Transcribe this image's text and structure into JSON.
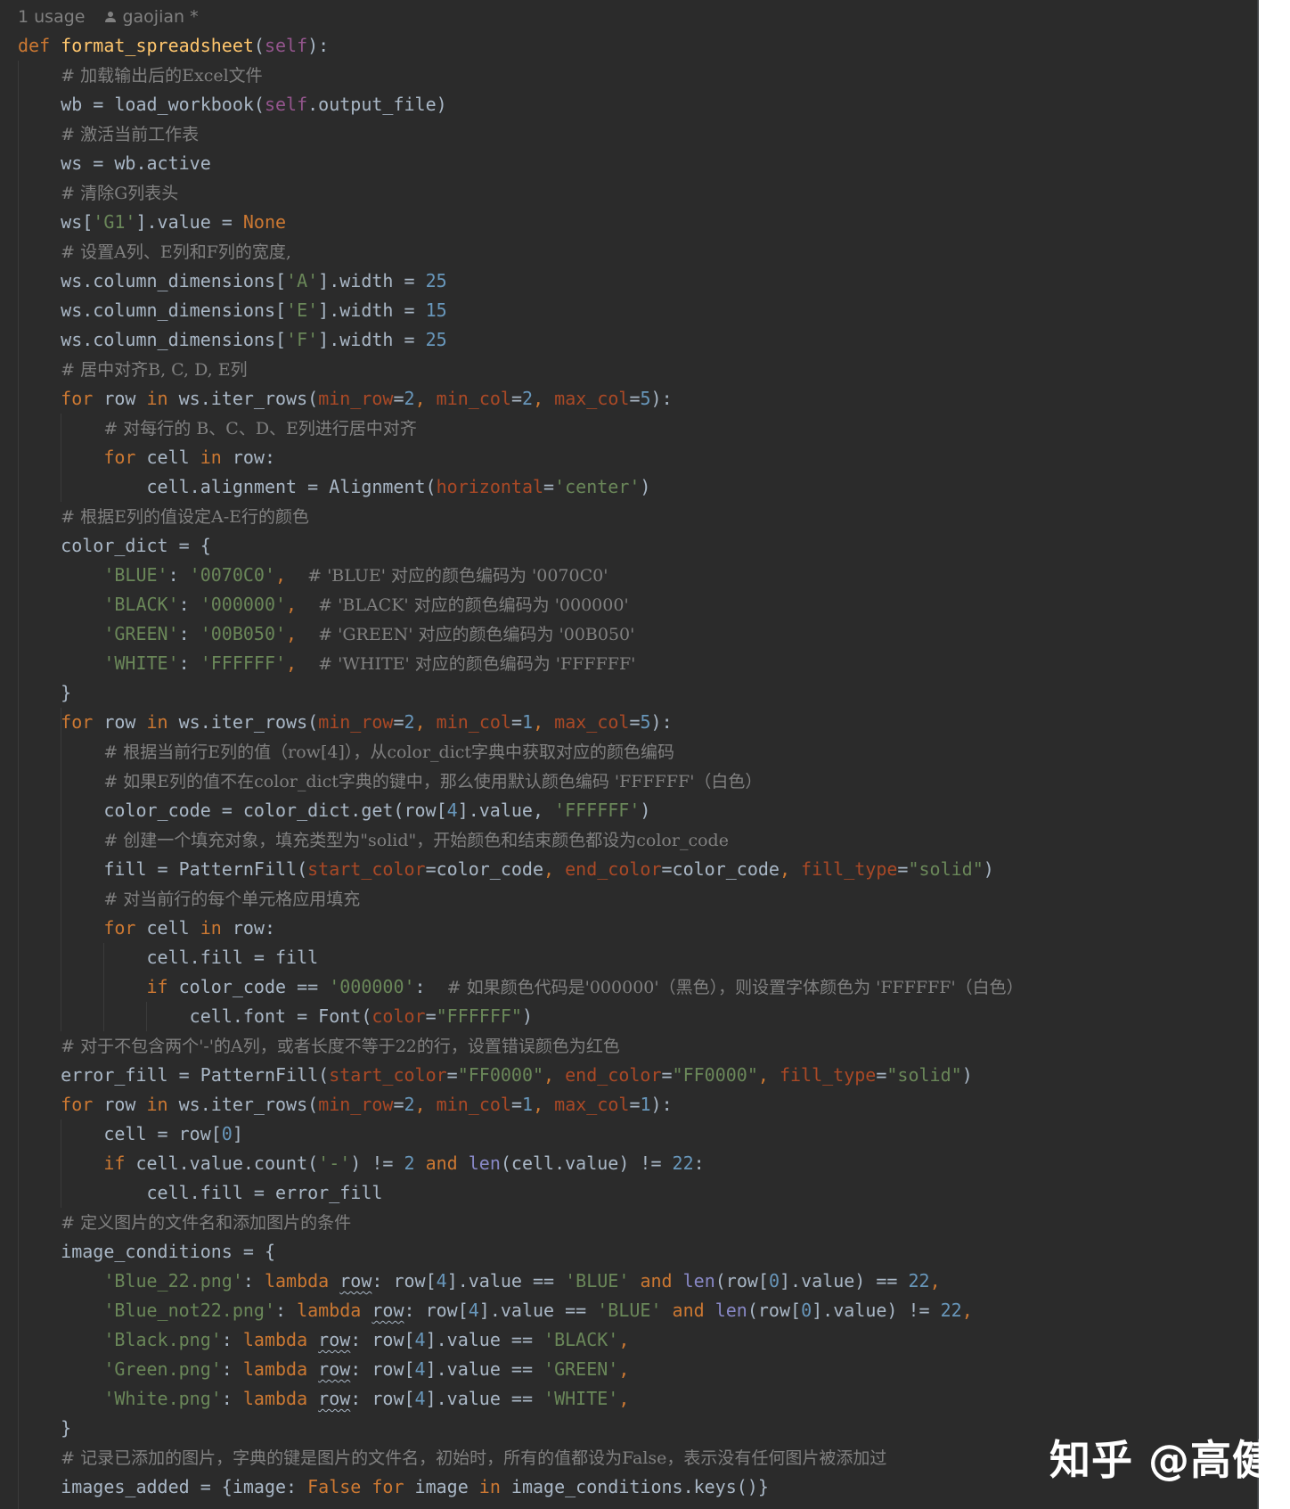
{
  "meta": {
    "usage": "1 usage",
    "author": "gaojian *"
  },
  "watermark": "知乎 @高健",
  "lines": [
    [
      {
        "t": "def ",
        "c": "kw"
      },
      {
        "t": "format_spreadsheet",
        "c": "fn"
      },
      {
        "t": "("
      },
      {
        "t": "self",
        "c": "self"
      },
      {
        "t": "):"
      }
    ],
    [
      {
        "t": "    "
      },
      {
        "t": "# 加载输出后的Excel文件",
        "c": "cm"
      }
    ],
    [
      {
        "t": "    wb = load_workbook("
      },
      {
        "t": "self",
        "c": "self"
      },
      {
        "t": ".output_file)"
      }
    ],
    [
      {
        "t": "    "
      },
      {
        "t": "# 激活当前工作表",
        "c": "cm"
      }
    ],
    [
      {
        "t": "    ws = wb.active"
      }
    ],
    [
      {
        "t": "    "
      },
      {
        "t": "# 清除G列表头",
        "c": "cm"
      }
    ],
    [
      {
        "t": "    ws["
      },
      {
        "t": "'G1'",
        "c": "str"
      },
      {
        "t": "].value = "
      },
      {
        "t": "None",
        "c": "kw"
      }
    ],
    [
      {
        "t": "    "
      },
      {
        "t": "# 设置A列、E列和F列的宽度,",
        "c": "cm"
      }
    ],
    [
      {
        "t": "    ws.column_dimensions["
      },
      {
        "t": "'A'",
        "c": "str"
      },
      {
        "t": "].width = "
      },
      {
        "t": "25",
        "c": "num"
      }
    ],
    [
      {
        "t": "    ws.column_dimensions["
      },
      {
        "t": "'E'",
        "c": "str"
      },
      {
        "t": "].width = "
      },
      {
        "t": "15",
        "c": "num"
      }
    ],
    [
      {
        "t": "    ws.column_dimensions["
      },
      {
        "t": "'F'",
        "c": "str"
      },
      {
        "t": "].width = "
      },
      {
        "t": "25",
        "c": "num"
      }
    ],
    [
      {
        "t": "    "
      },
      {
        "t": "# 居中对齐B, C, D, E列",
        "c": "cm"
      }
    ],
    [
      {
        "t": "    "
      },
      {
        "t": "for ",
        "c": "kw"
      },
      {
        "t": "row "
      },
      {
        "t": "in ",
        "c": "kw"
      },
      {
        "t": "ws.iter_rows("
      },
      {
        "t": "min_row",
        "c": "param"
      },
      {
        "t": "="
      },
      {
        "t": "2",
        "c": "num"
      },
      {
        "t": ", ",
        "c": "kw"
      },
      {
        "t": "min_col",
        "c": "param"
      },
      {
        "t": "="
      },
      {
        "t": "2",
        "c": "num"
      },
      {
        "t": ", ",
        "c": "kw"
      },
      {
        "t": "max_col",
        "c": "param"
      },
      {
        "t": "="
      },
      {
        "t": "5",
        "c": "num"
      },
      {
        "t": "):"
      }
    ],
    [
      {
        "t": "        "
      },
      {
        "t": "# 对每行的 B、C、D、E列进行居中对齐",
        "c": "cm"
      }
    ],
    [
      {
        "t": "        "
      },
      {
        "t": "for ",
        "c": "kw"
      },
      {
        "t": "cell "
      },
      {
        "t": "in ",
        "c": "kw"
      },
      {
        "t": "row:"
      }
    ],
    [
      {
        "t": "            cell.alignment = Alignment("
      },
      {
        "t": "horizontal",
        "c": "param"
      },
      {
        "t": "="
      },
      {
        "t": "'center'",
        "c": "str"
      },
      {
        "t": ")"
      }
    ],
    [
      {
        "t": "    "
      },
      {
        "t": "# 根据E列的值设定A-E行的颜色",
        "c": "cm"
      }
    ],
    [
      {
        "t": "    color_dict = {"
      }
    ],
    [
      {
        "t": "        "
      },
      {
        "t": "'BLUE'",
        "c": "str"
      },
      {
        "t": ": "
      },
      {
        "t": "'0070C0'",
        "c": "str"
      },
      {
        "t": ",  ",
        "c": "kw"
      },
      {
        "t": "# 'BLUE' 对应的颜色编码为 '0070C0'",
        "c": "cm"
      }
    ],
    [
      {
        "t": "        "
      },
      {
        "t": "'BLACK'",
        "c": "str"
      },
      {
        "t": ": "
      },
      {
        "t": "'000000'",
        "c": "str"
      },
      {
        "t": ",  ",
        "c": "kw"
      },
      {
        "t": "# 'BLACK' 对应的颜色编码为 '000000'",
        "c": "cm"
      }
    ],
    [
      {
        "t": "        "
      },
      {
        "t": "'GREEN'",
        "c": "str"
      },
      {
        "t": ": "
      },
      {
        "t": "'00B050'",
        "c": "str"
      },
      {
        "t": ",  ",
        "c": "kw"
      },
      {
        "t": "# 'GREEN' 对应的颜色编码为 '00B050'",
        "c": "cm"
      }
    ],
    [
      {
        "t": "        "
      },
      {
        "t": "'WHITE'",
        "c": "str"
      },
      {
        "t": ": "
      },
      {
        "t": "'FFFFFF'",
        "c": "str"
      },
      {
        "t": ",  ",
        "c": "kw"
      },
      {
        "t": "# 'WHITE' 对应的颜色编码为 'FFFFFF'",
        "c": "cm"
      }
    ],
    [
      {
        "t": "    }"
      }
    ],
    [
      {
        "t": "    "
      },
      {
        "t": "for ",
        "c": "kw"
      },
      {
        "t": "row "
      },
      {
        "t": "in ",
        "c": "kw"
      },
      {
        "t": "ws.iter_rows("
      },
      {
        "t": "min_row",
        "c": "param"
      },
      {
        "t": "="
      },
      {
        "t": "2",
        "c": "num"
      },
      {
        "t": ", ",
        "c": "kw"
      },
      {
        "t": "min_col",
        "c": "param"
      },
      {
        "t": "="
      },
      {
        "t": "1",
        "c": "num"
      },
      {
        "t": ", ",
        "c": "kw"
      },
      {
        "t": "max_col",
        "c": "param"
      },
      {
        "t": "="
      },
      {
        "t": "5",
        "c": "num"
      },
      {
        "t": "):"
      }
    ],
    [
      {
        "t": "        "
      },
      {
        "t": "# 根据当前行E列的值（row[4]），从color_dict字典中获取对应的颜色编码",
        "c": "cm"
      }
    ],
    [
      {
        "t": "        "
      },
      {
        "t": "# 如果E列的值不在color_dict字典的键中，那么使用默认颜色编码 'FFFFFF'（白色）",
        "c": "cm"
      }
    ],
    [
      {
        "t": "        color_code = color_dict.get(row["
      },
      {
        "t": "4",
        "c": "num"
      },
      {
        "t": "].value, "
      },
      {
        "t": "'FFFFFF'",
        "c": "str"
      },
      {
        "t": ")"
      }
    ],
    [
      {
        "t": "        "
      },
      {
        "t": "# 创建一个填充对象，填充类型为\"solid\"，开始颜色和结束颜色都设为color_code",
        "c": "cm"
      }
    ],
    [
      {
        "t": "        fill = PatternFill("
      },
      {
        "t": "start_color",
        "c": "param"
      },
      {
        "t": "=color_code"
      },
      {
        "t": ", ",
        "c": "kw"
      },
      {
        "t": "end_color",
        "c": "param"
      },
      {
        "t": "=color_code"
      },
      {
        "t": ", ",
        "c": "kw"
      },
      {
        "t": "fill_type",
        "c": "param"
      },
      {
        "t": "="
      },
      {
        "t": "\"solid\"",
        "c": "str"
      },
      {
        "t": ")"
      }
    ],
    [
      {
        "t": "        "
      },
      {
        "t": "# 对当前行的每个单元格应用填充",
        "c": "cm"
      }
    ],
    [
      {
        "t": "        "
      },
      {
        "t": "for ",
        "c": "kw"
      },
      {
        "t": "cell "
      },
      {
        "t": "in ",
        "c": "kw"
      },
      {
        "t": "row:"
      }
    ],
    [
      {
        "t": "            cell.fill = fill"
      }
    ],
    [
      {
        "t": "            "
      },
      {
        "t": "if ",
        "c": "kw"
      },
      {
        "t": "color_code == "
      },
      {
        "t": "'000000'",
        "c": "str"
      },
      {
        "t": ":  "
      },
      {
        "t": "# 如果颜色代码是'000000'（黑色），则设置字体颜色为 'FFFFFF'（白色）",
        "c": "cm"
      }
    ],
    [
      {
        "t": "                cell.font = Font("
      },
      {
        "t": "color",
        "c": "param"
      },
      {
        "t": "="
      },
      {
        "t": "\"FFFFFF\"",
        "c": "str"
      },
      {
        "t": ")"
      }
    ],
    [
      {
        "t": "    "
      },
      {
        "t": "# 对于不包含两个'-'的A列，或者长度不等于22的行，设置错误颜色为红色",
        "c": "cm"
      }
    ],
    [
      {
        "t": "    error_fill = PatternFill("
      },
      {
        "t": "start_color",
        "c": "param"
      },
      {
        "t": "="
      },
      {
        "t": "\"FF0000\"",
        "c": "str"
      },
      {
        "t": ", ",
        "c": "kw"
      },
      {
        "t": "end_color",
        "c": "param"
      },
      {
        "t": "="
      },
      {
        "t": "\"FF0000\"",
        "c": "str"
      },
      {
        "t": ", ",
        "c": "kw"
      },
      {
        "t": "fill_type",
        "c": "param"
      },
      {
        "t": "="
      },
      {
        "t": "\"solid\"",
        "c": "str"
      },
      {
        "t": ")"
      }
    ],
    [
      {
        "t": "    "
      },
      {
        "t": "for ",
        "c": "kw"
      },
      {
        "t": "row "
      },
      {
        "t": "in ",
        "c": "kw"
      },
      {
        "t": "ws.iter_rows("
      },
      {
        "t": "min_row",
        "c": "param"
      },
      {
        "t": "="
      },
      {
        "t": "2",
        "c": "num"
      },
      {
        "t": ", ",
        "c": "kw"
      },
      {
        "t": "min_col",
        "c": "param"
      },
      {
        "t": "="
      },
      {
        "t": "1",
        "c": "num"
      },
      {
        "t": ", ",
        "c": "kw"
      },
      {
        "t": "max_col",
        "c": "param"
      },
      {
        "t": "="
      },
      {
        "t": "1",
        "c": "num"
      },
      {
        "t": "):"
      }
    ],
    [
      {
        "t": "        cell = row["
      },
      {
        "t": "0",
        "c": "num"
      },
      {
        "t": "]"
      }
    ],
    [
      {
        "t": "        "
      },
      {
        "t": "if ",
        "c": "kw"
      },
      {
        "t": "cell.value.count("
      },
      {
        "t": "'-'",
        "c": "str"
      },
      {
        "t": ") != "
      },
      {
        "t": "2 ",
        "c": "num"
      },
      {
        "t": "and ",
        "c": "kw"
      },
      {
        "t": "len",
        "c": "builtin"
      },
      {
        "t": "(cell.value) != "
      },
      {
        "t": "22",
        "c": "num"
      },
      {
        "t": ":"
      }
    ],
    [
      {
        "t": "            cell.fill = error_fill"
      }
    ],
    [
      {
        "t": "    "
      },
      {
        "t": "# 定义图片的文件名和添加图片的条件",
        "c": "cm"
      }
    ],
    [
      {
        "t": "    image_conditions = {"
      }
    ],
    [
      {
        "t": "        "
      },
      {
        "t": "'Blue_22.png'",
        "c": "str"
      },
      {
        "t": ": "
      },
      {
        "t": "lambda ",
        "c": "kw"
      },
      {
        "t": "row",
        "c": "wavy"
      },
      {
        "t": ": row["
      },
      {
        "t": "4",
        "c": "num"
      },
      {
        "t": "].value == "
      },
      {
        "t": "'BLUE' ",
        "c": "str"
      },
      {
        "t": "and ",
        "c": "kw"
      },
      {
        "t": "len",
        "c": "builtin"
      },
      {
        "t": "(row["
      },
      {
        "t": "0",
        "c": "num"
      },
      {
        "t": "].value) == "
      },
      {
        "t": "22",
        "c": "num"
      },
      {
        "t": ",",
        "c": "kw"
      }
    ],
    [
      {
        "t": "        "
      },
      {
        "t": "'Blue_not22.png'",
        "c": "str"
      },
      {
        "t": ": "
      },
      {
        "t": "lambda ",
        "c": "kw"
      },
      {
        "t": "row",
        "c": "wavy"
      },
      {
        "t": ": row["
      },
      {
        "t": "4",
        "c": "num"
      },
      {
        "t": "].value == "
      },
      {
        "t": "'BLUE' ",
        "c": "str"
      },
      {
        "t": "and ",
        "c": "kw"
      },
      {
        "t": "len",
        "c": "builtin"
      },
      {
        "t": "(row["
      },
      {
        "t": "0",
        "c": "num"
      },
      {
        "t": "].value) != "
      },
      {
        "t": "22",
        "c": "num"
      },
      {
        "t": ",",
        "c": "kw"
      }
    ],
    [
      {
        "t": "        "
      },
      {
        "t": "'Black.png'",
        "c": "str"
      },
      {
        "t": ": "
      },
      {
        "t": "lambda ",
        "c": "kw"
      },
      {
        "t": "row",
        "c": "wavy"
      },
      {
        "t": ": row["
      },
      {
        "t": "4",
        "c": "num"
      },
      {
        "t": "].value == "
      },
      {
        "t": "'BLACK'",
        "c": "str"
      },
      {
        "t": ",",
        "c": "kw"
      }
    ],
    [
      {
        "t": "        "
      },
      {
        "t": "'Green.png'",
        "c": "str"
      },
      {
        "t": ": "
      },
      {
        "t": "lambda ",
        "c": "kw"
      },
      {
        "t": "row",
        "c": "wavy"
      },
      {
        "t": ": row["
      },
      {
        "t": "4",
        "c": "num"
      },
      {
        "t": "].value == "
      },
      {
        "t": "'GREEN'",
        "c": "str"
      },
      {
        "t": ",",
        "c": "kw"
      }
    ],
    [
      {
        "t": "        "
      },
      {
        "t": "'White.png'",
        "c": "str"
      },
      {
        "t": ": "
      },
      {
        "t": "lambda ",
        "c": "kw"
      },
      {
        "t": "row",
        "c": "wavy"
      },
      {
        "t": ": row["
      },
      {
        "t": "4",
        "c": "num"
      },
      {
        "t": "].value == "
      },
      {
        "t": "'WHITE'",
        "c": "str"
      },
      {
        "t": ",",
        "c": "kw"
      }
    ],
    [
      {
        "t": "    }"
      }
    ],
    [
      {
        "t": "    "
      },
      {
        "t": "# 记录已添加的图片，字典的键是图片的文件名，初始时，所有的值都设为False，表示没有任何图片被添加过",
        "c": "cm"
      }
    ],
    [
      {
        "t": "    images_added = {image: "
      },
      {
        "t": "False ",
        "c": "kw"
      },
      {
        "t": "for ",
        "c": "kw"
      },
      {
        "t": "image "
      },
      {
        "t": "in ",
        "c": "kw"
      },
      {
        "t": "image_conditions.keys()}"
      }
    ]
  ]
}
